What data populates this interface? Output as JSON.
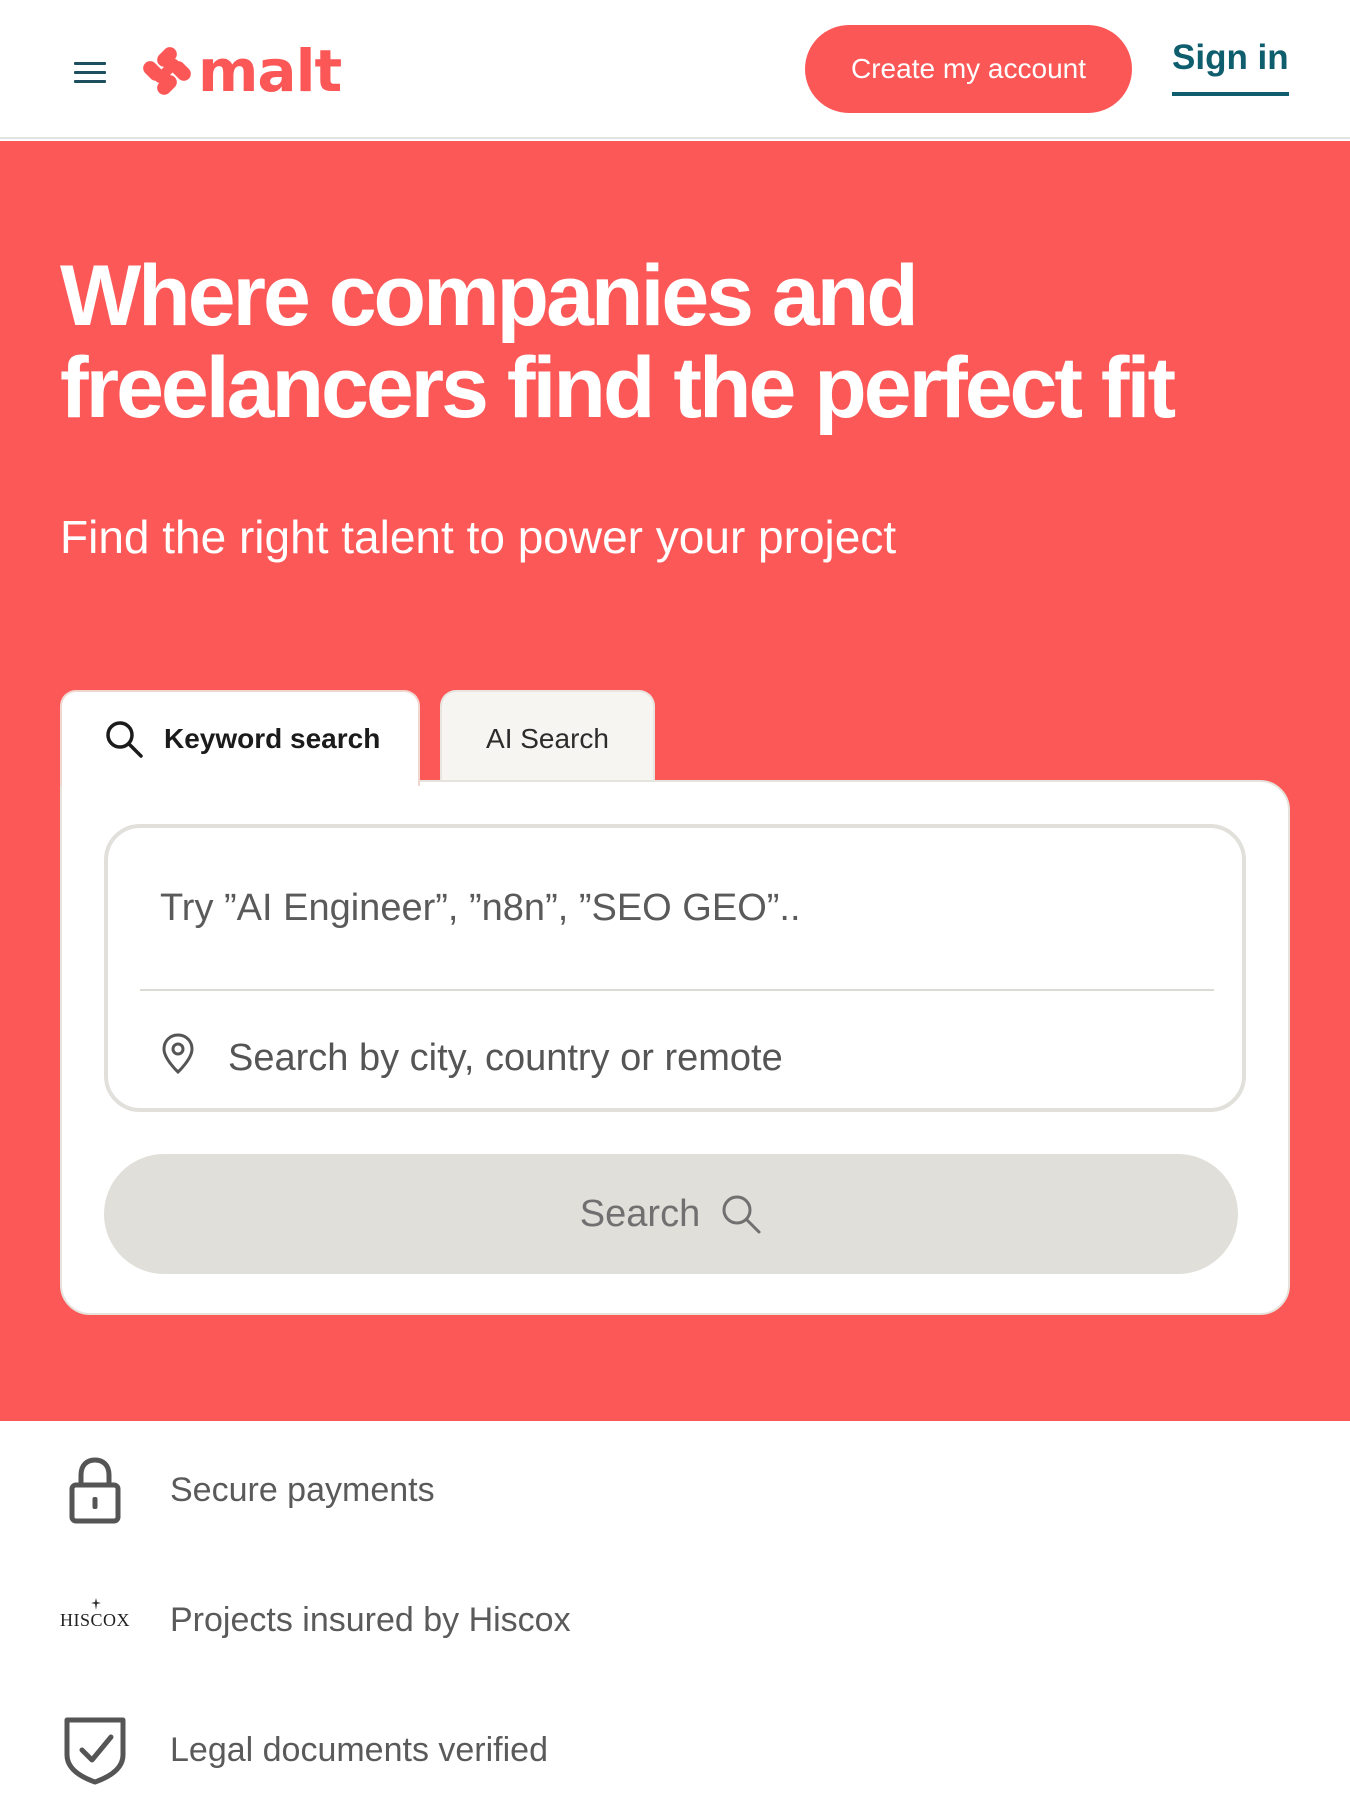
{
  "header": {
    "logo_text": "malt",
    "create_account_label": "Create my account",
    "sign_in_label": "Sign in"
  },
  "hero": {
    "title": "Where companies and freelancers find the perfect fit",
    "subtitle": "Find the right talent to power your project"
  },
  "search": {
    "tabs": [
      {
        "label": "Keyword search",
        "active": true
      },
      {
        "label": "AI Search",
        "active": false
      }
    ],
    "keyword_placeholder": "Try ”AI Engineer”, ”n8n”, ”SEO GEO”..",
    "location_placeholder": "Search by city, country or remote",
    "button_label": "Search"
  },
  "features": [
    {
      "icon": "lock-icon",
      "label": "Secure payments"
    },
    {
      "icon": "hiscox-logo",
      "logo_text": "HISCOX",
      "label": "Projects insured by Hiscox"
    },
    {
      "icon": "shield-check-icon",
      "label": "Legal documents verified"
    }
  ],
  "colors": {
    "brand": "#fc5757",
    "accent_teal": "#0f5e6e",
    "button_disabled": "#e0dfda"
  }
}
